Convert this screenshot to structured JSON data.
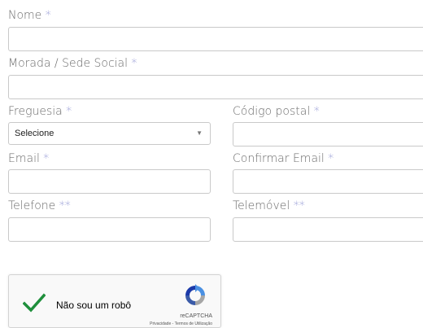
{
  "form": {
    "nome_label": "Nome",
    "morada_label": "Morada / Sede Social",
    "freguesia_label": "Freguesia",
    "codigo_postal_label": "Código postal",
    "email_label": "Email",
    "confirmar_email_label": "Confirmar Email",
    "telefone_label": "Telefone",
    "telemovel_label": "Telemóvel",
    "required_mark": "*",
    "double_required_mark": "**",
    "freguesia_selected": "Selecione",
    "nome_value": "",
    "morada_value": "",
    "codigo_postal_value": "",
    "email_value": "",
    "confirmar_email_value": "",
    "telefone_value": "",
    "telemovel_value": ""
  },
  "captcha": {
    "label": "Não sou um robô",
    "brand": "reCAPTCHA",
    "links": "Privacidade - Termos de Utilização",
    "checked": true,
    "check_color": "#1f8f3c"
  },
  "colors": {
    "required_mark": "#8a8fd0",
    "label_text": "#6b6b6b",
    "input_border": "#c9c9c9"
  }
}
